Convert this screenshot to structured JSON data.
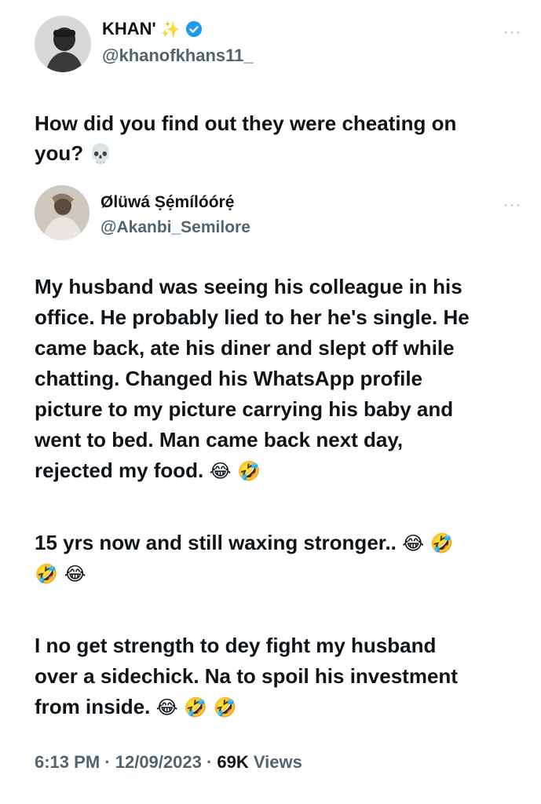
{
  "tweet": {
    "display_name": "KHAN'",
    "sparkle": "✨",
    "handle": "@khanofkhans11_",
    "more": "···",
    "text_line1": "How did you find out they were cheating on",
    "text_line2": "you?",
    "text_emoji": "💀"
  },
  "quote": {
    "display_name": "Ølüwá Ṣẹ́mílóórẹ́",
    "handle": "@Akanbi_Semilore",
    "more": "···",
    "paragraphs": [
      {
        "lines": [
          "My husband was seeing his colleague in his",
          "office. He probably lied to her he's single. He",
          "came back, ate his diner and slept off while",
          "chatting. Changed his WhatsApp profile",
          "picture to my picture carrying his baby and",
          "went to bed. Man came back next day,",
          "rejected my food."
        ],
        "emoji": "😂 🤣"
      },
      {
        "lines": [
          "15 yrs now and still waxing stronger.."
        ],
        "emoji": "😂 🤣",
        "emoji2": "🤣 😂"
      },
      {
        "lines": [
          "I no get strength to dey fight my husband",
          "over a sidechick. Na to spoil his investment",
          "from inside."
        ],
        "emoji": "😂 🤣 🤣"
      }
    ]
  },
  "meta": {
    "time": "6:13 PM",
    "date": "12/09/2023",
    "views_count": "69K",
    "views_label": "Views",
    "sep": "·"
  },
  "colors": {
    "text": "#0f1419",
    "secondary": "#536471",
    "verified": "#1d9bf0"
  },
  "icons": {
    "verified": "verified-badge-icon",
    "more": "more-options-icon"
  }
}
